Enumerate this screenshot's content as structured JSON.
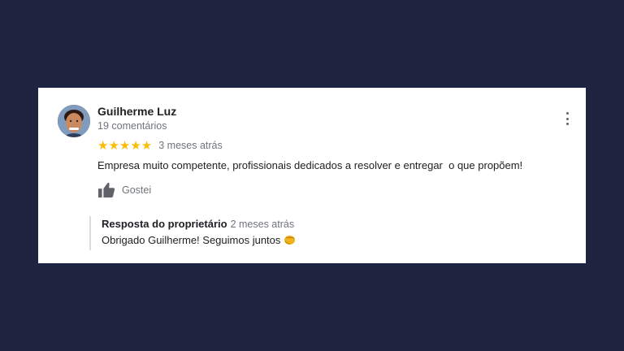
{
  "review": {
    "author_name": "Guilherme Luz",
    "author_meta": "19 comentários",
    "rating_stars": "★★★★★",
    "rating_value": 5,
    "date": "3 meses atrás",
    "text": "Empresa muito competente, profissionais dedicados a resolver e entregar  o que propõem!",
    "like_label": "Gostei",
    "more_icon": "more-vert-icon",
    "like_icon": "thumbs-up-icon"
  },
  "owner_reply": {
    "title": "Resposta do proprietário",
    "date": "2 meses atrás",
    "text": "Obrigado Guilherme! Seguimos juntos",
    "emoji_icon": "fist-bump-icon"
  },
  "colors": {
    "background": "#1e2340",
    "card": "#ffffff",
    "star": "#fbbc04",
    "secondary_text": "#70757a"
  }
}
